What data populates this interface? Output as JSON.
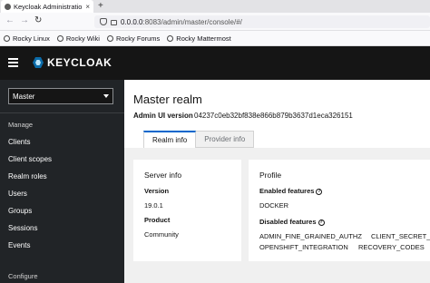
{
  "browser": {
    "tab_title": "Keycloak Administration C",
    "tab_close": "×",
    "new_tab": "+",
    "url_host": "0.0.0.0",
    "url_rest": ":8083/admin/master/console/#/",
    "bookmarks": [
      "Rocky Linux",
      "Rocky Wiki",
      "Rocky Forums",
      "Rocky Mattermost"
    ]
  },
  "masthead": {
    "brand": "KEYCLOAK"
  },
  "sidebar": {
    "realm_selected": "Master",
    "group_manage": "Manage",
    "items": [
      "Clients",
      "Client scopes",
      "Realm roles",
      "Users",
      "Groups",
      "Sessions",
      "Events"
    ],
    "group_configure": "Configure"
  },
  "main": {
    "title": "Master realm",
    "admin_ui_label": "Admin UI version",
    "admin_ui_value": "04237c0eb32bf838e866b879b3637d1eca326151",
    "tabs": [
      "Realm info",
      "Provider info"
    ],
    "server_info": {
      "title": "Server info",
      "version_label": "Version",
      "version_value": "19.0.1",
      "product_label": "Product",
      "product_value": "Community"
    },
    "profile": {
      "title": "Profile",
      "enabled_label": "Enabled features",
      "enabled_value": "DOCKER",
      "disabled_label": "Disabled features",
      "disabled_row1": [
        "ADMIN_FINE_GRAINED_AUTHZ",
        "CLIENT_SECRET_"
      ],
      "disabled_row2": [
        "OPENSHIFT_INTEGRATION",
        "RECOVERY_CODES"
      ]
    }
  }
}
